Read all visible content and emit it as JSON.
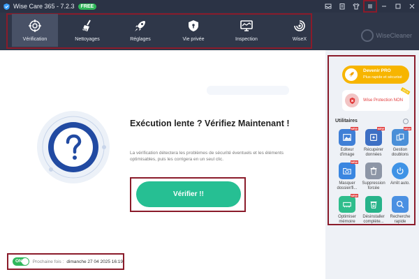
{
  "app": {
    "title": "Wise Care 365 - 7.2.3",
    "badge": "FREE",
    "brand": "WiseCleaner"
  },
  "titlebar_icons": [
    "inbox-icon",
    "clipboard-icon",
    "shirt-icon",
    "menu-icon",
    "minimize-icon",
    "maximize-icon",
    "close-icon"
  ],
  "nav": {
    "items": [
      {
        "label": "Vérification",
        "icon": "crosshair-icon",
        "active": true
      },
      {
        "label": "Nettoyages",
        "icon": "broom-icon",
        "active": false
      },
      {
        "label": "Réglages",
        "icon": "rocket-icon",
        "active": false
      },
      {
        "label": "Vie privée",
        "icon": "shield-lock-icon",
        "active": false
      },
      {
        "label": "Inspection",
        "icon": "monitor-icon",
        "active": false
      },
      {
        "label": "WiseX",
        "icon": "spiral-icon",
        "active": false
      }
    ]
  },
  "main": {
    "headline": "Exécution lente ? Vérifiez Maintenant !",
    "description": "La vérification détectera les problèmes de sécurité éventuels et les éléments optimisables, puis les corrigera en un seul clic.",
    "verify_label": "Vérifier !!",
    "toggle_label": "ON",
    "next_label": "Prochaine fois :",
    "next_date": "dimanche 27 04 2025 16:19"
  },
  "side": {
    "pro_title": "Devenir PRO",
    "pro_subtitle": "Plus rapide et sécurisé",
    "protection_label": "Wise Protection NON",
    "utilities_title": "Utilitaires",
    "new_tag": "NEW",
    "tools": [
      {
        "line1": "Editeur",
        "line2": "d'image",
        "icon": "image-editor-icon",
        "color": "#3f7fd6",
        "new": true
      },
      {
        "line1": "Récupérer",
        "line2": "données",
        "icon": "data-recovery-icon",
        "color": "#3d6fc4",
        "new": true
      },
      {
        "line1": "Gestion",
        "line2": "doublons",
        "icon": "duplicates-icon",
        "color": "#4a8fd8",
        "new": true
      },
      {
        "line1": "Masquer",
        "line2": "dossier/fi...",
        "icon": "hide-folder-icon",
        "color": "#3a86e0",
        "new": true
      },
      {
        "line1": "Suppression",
        "line2": "forcée",
        "icon": "force-delete-icon",
        "color": "#8d96a6",
        "new": false
      },
      {
        "line1": "Arrêt auto.",
        "line2": "",
        "icon": "power-icon",
        "color": "#3f93e6",
        "new": false
      },
      {
        "line1": "Optimiser",
        "line2": "mémoire",
        "icon": "memory-icon",
        "color": "#2fbd8c",
        "new": true
      },
      {
        "line1": "Désinstaller",
        "line2": "complète...",
        "icon": "uninstall-icon",
        "color": "#27b38a",
        "new": false
      },
      {
        "line1": "Recherche",
        "line2": "rapide",
        "icon": "search-icon",
        "color": "#4a90e2",
        "new": false
      }
    ]
  }
}
